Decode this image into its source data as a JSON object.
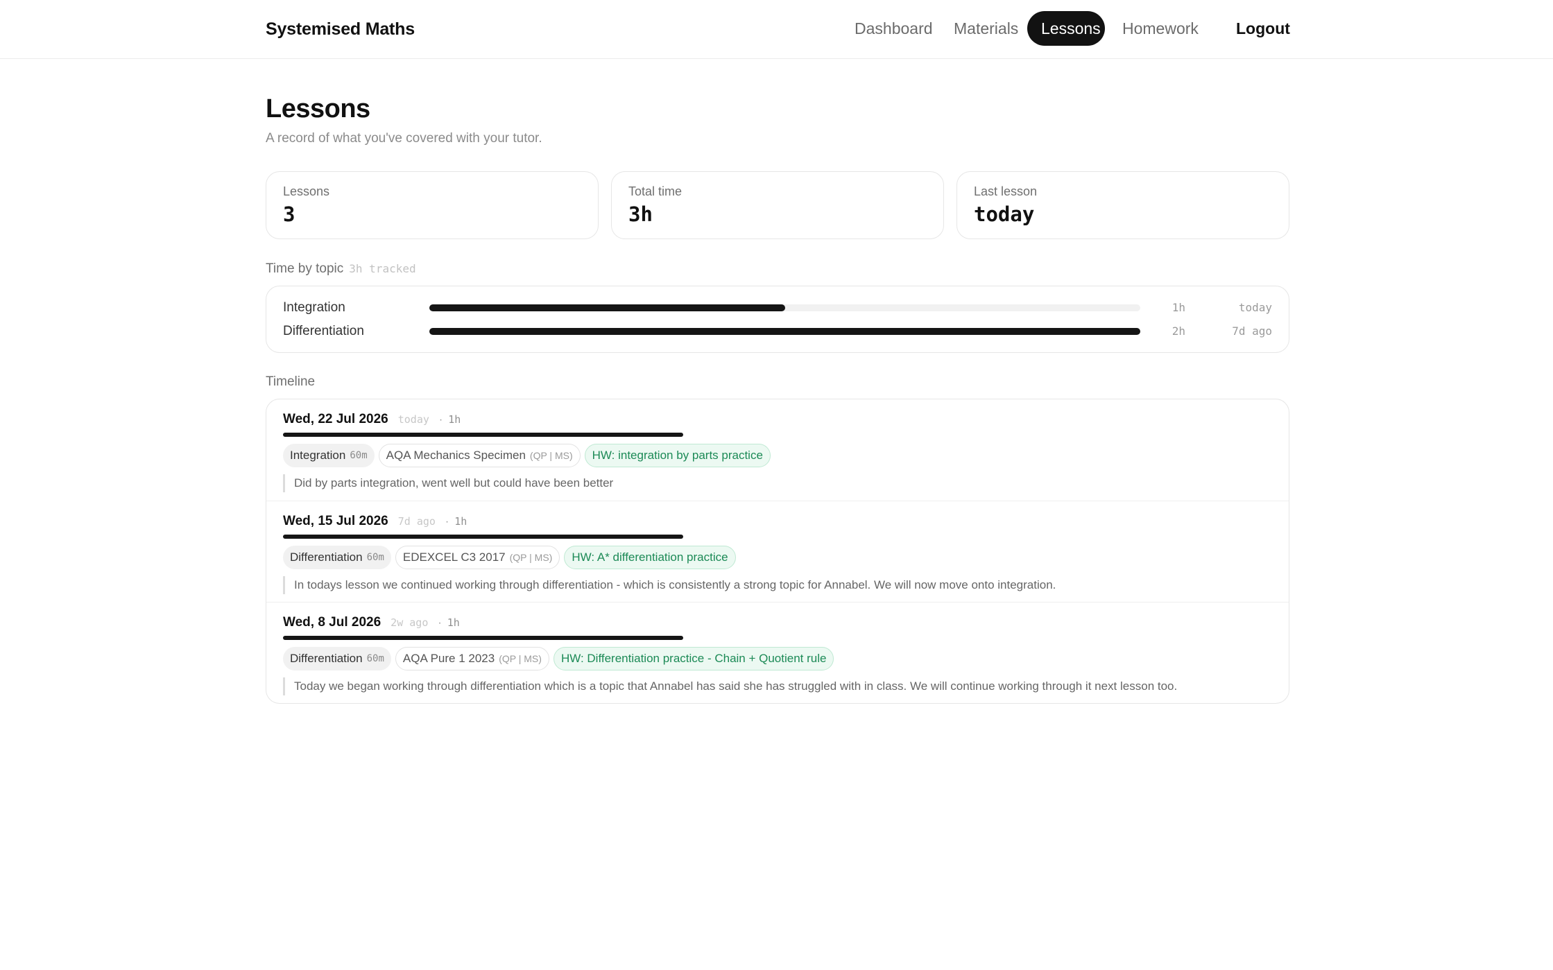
{
  "header": {
    "brand": "Systemised Maths",
    "nav": {
      "dashboard": "Dashboard",
      "materials": "Materials",
      "lessons": "Lessons",
      "homework": "Homework",
      "logout": "Logout"
    },
    "active": "Lessons"
  },
  "page": {
    "title": "Lessons",
    "subtitle": "A record of what you've covered with your tutor."
  },
  "stats": {
    "lessons": {
      "label": "Lessons",
      "value": "3"
    },
    "total_time": {
      "label": "Total time",
      "value": "3h"
    },
    "last_lesson": {
      "label": "Last lesson",
      "value": "today"
    }
  },
  "time_by_topic": {
    "label": "Time by topic",
    "meta": "3h tracked",
    "topics": [
      {
        "name": "Integration",
        "hours": "1h",
        "ago": "today",
        "fraction": 0.5
      },
      {
        "name": "Differentiation",
        "hours": "2h",
        "ago": "7d ago",
        "fraction": 1.0
      }
    ]
  },
  "timeline": {
    "label": "Timeline",
    "entries": [
      {
        "date": "Wed, 22 Jul 2026",
        "ago": "today",
        "dot": "·",
        "duration": "1h",
        "topic": "Integration",
        "topic_minutes": "60m",
        "paper": "AQA Mechanics Specimen",
        "paper_links": "(QP | MS)",
        "homework": "HW: integration by parts practice",
        "note": "Did by parts integration, went well but could have been better"
      },
      {
        "date": "Wed, 15 Jul 2026",
        "ago": "7d ago",
        "dot": "·",
        "duration": "1h",
        "topic": "Differentiation",
        "topic_minutes": "60m",
        "paper": "EDEXCEL C3 2017",
        "paper_links": "(QP | MS)",
        "homework": "HW: A* differentiation practice",
        "note": "In todays lesson we continued working through differentiation - which is consistently a strong topic for Annabel. We will now move onto integration."
      },
      {
        "date": "Wed, 8 Jul 2026",
        "ago": "2w ago",
        "dot": "·",
        "duration": "1h",
        "topic": "Differentiation",
        "topic_minutes": "60m",
        "paper": "AQA Pure 1 2023",
        "paper_links": "(QP | MS)",
        "homework": "HW: Differentiation practice - Chain + Quotient rule",
        "note": "Today we began working through differentiation which is a topic that Annabel has said she has struggled with in class. We will continue working through it next lesson too."
      }
    ]
  },
  "colors": {
    "accent": "#121212",
    "homework_text": "#1c8a56",
    "homework_bg": "#ecf9f2"
  }
}
